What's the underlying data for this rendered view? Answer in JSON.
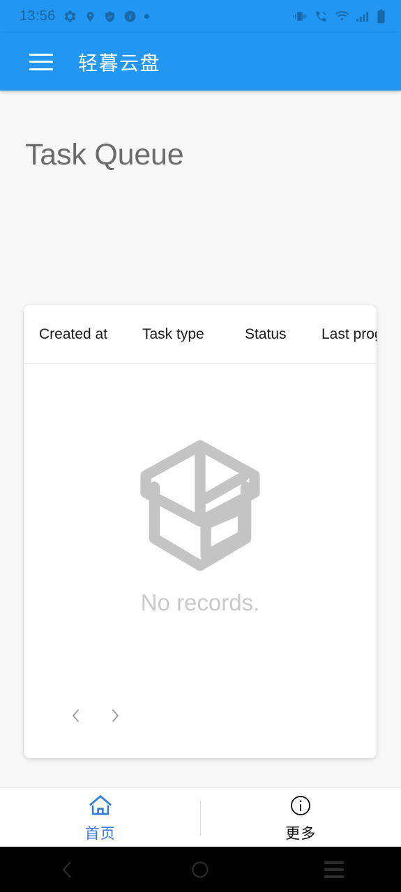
{
  "status_bar": {
    "time": "13:56",
    "left_icons": [
      "gear-icon",
      "location-pin-icon",
      "shield-check-icon",
      "speedometer-icon",
      "dot-icon"
    ],
    "right_icons": [
      "vibrate-icon",
      "call-muted-icon",
      "wifi-icon",
      "cellular-signal-icon",
      "battery-icon"
    ],
    "bg_color": "#2196f3",
    "icon_color": "#1a68a6"
  },
  "app_bar": {
    "menu_icon": "hamburger-menu-icon",
    "title": "轻暮云盘",
    "bg_color": "#2196f3",
    "text_color": "#ffffff"
  },
  "page": {
    "title": "Task Queue",
    "title_color": "#6b6b6b",
    "bg_color": "#f8f8f8"
  },
  "task_table": {
    "columns": [
      {
        "label": "Created at"
      },
      {
        "label": "Task type"
      },
      {
        "label": "Status"
      },
      {
        "label": "Last progr"
      }
    ],
    "rows": [],
    "empty": {
      "icon": "empty-box-icon",
      "text": "No records.",
      "text_color": "#c9c9c9",
      "icon_color": "#c4c4c4"
    },
    "pagination": {
      "prev_icon": "chevron-left-icon",
      "next_icon": "chevron-right-icon",
      "arrow_color": "#9a9a9a"
    }
  },
  "tab_bar": {
    "tabs": [
      {
        "icon": "home-icon",
        "label": "首页",
        "active": true,
        "color": "#3879d9"
      },
      {
        "icon": "info-circle-icon",
        "label": "更多",
        "active": false,
        "color": "#111111"
      }
    ]
  },
  "android_nav": {
    "back_icon": "nav-back-icon",
    "home_icon": "nav-home-icon",
    "recents_icon": "nav-recents-icon",
    "bg_color": "#000000",
    "icon_color": "#2c2c2c"
  }
}
